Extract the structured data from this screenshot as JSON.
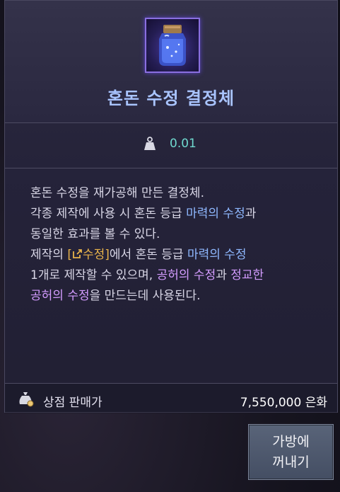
{
  "item": {
    "name": "혼돈 수정 결정체",
    "icon": "crystal-jar-icon",
    "weight": "0.01",
    "colors": {
      "name": "#a9c4ff",
      "weight": "#6fd9cf",
      "highlight_blue": "#8fb8ff",
      "highlight_purple": "#d39cff",
      "link_gold": "#e8b34a"
    }
  },
  "description": {
    "line1": "혼돈 수정을 재가공해 만든 결정체.",
    "line2_a": "각종 제작에 사용 시 혼돈 등급 ",
    "line2_hl": "마력의 수정",
    "line2_b": "과",
    "line3": "동일한 효과를 볼 수 있다.",
    "line4_a": "제작의 ",
    "line4_link": "[",
    "line4_link_text": "수정]",
    "line4_b": "에서 혼돈 등급 ",
    "line4_hl": "마력의 수정",
    "line5_a": "1개로 제작할 수 있으며, ",
    "line5_hl": "공허의 수정",
    "line5_b": "과 ",
    "line5_hl2": "정교한",
    "line6_hl": "공허의 수정",
    "line6_b": "을 만드는데 사용된다."
  },
  "price": {
    "label": "상점 판매가",
    "value": "7,550,000 은화",
    "icon": "money-bag-icon"
  },
  "actions": {
    "take_out_line1": "가방에",
    "take_out_line2": "꺼내기"
  }
}
